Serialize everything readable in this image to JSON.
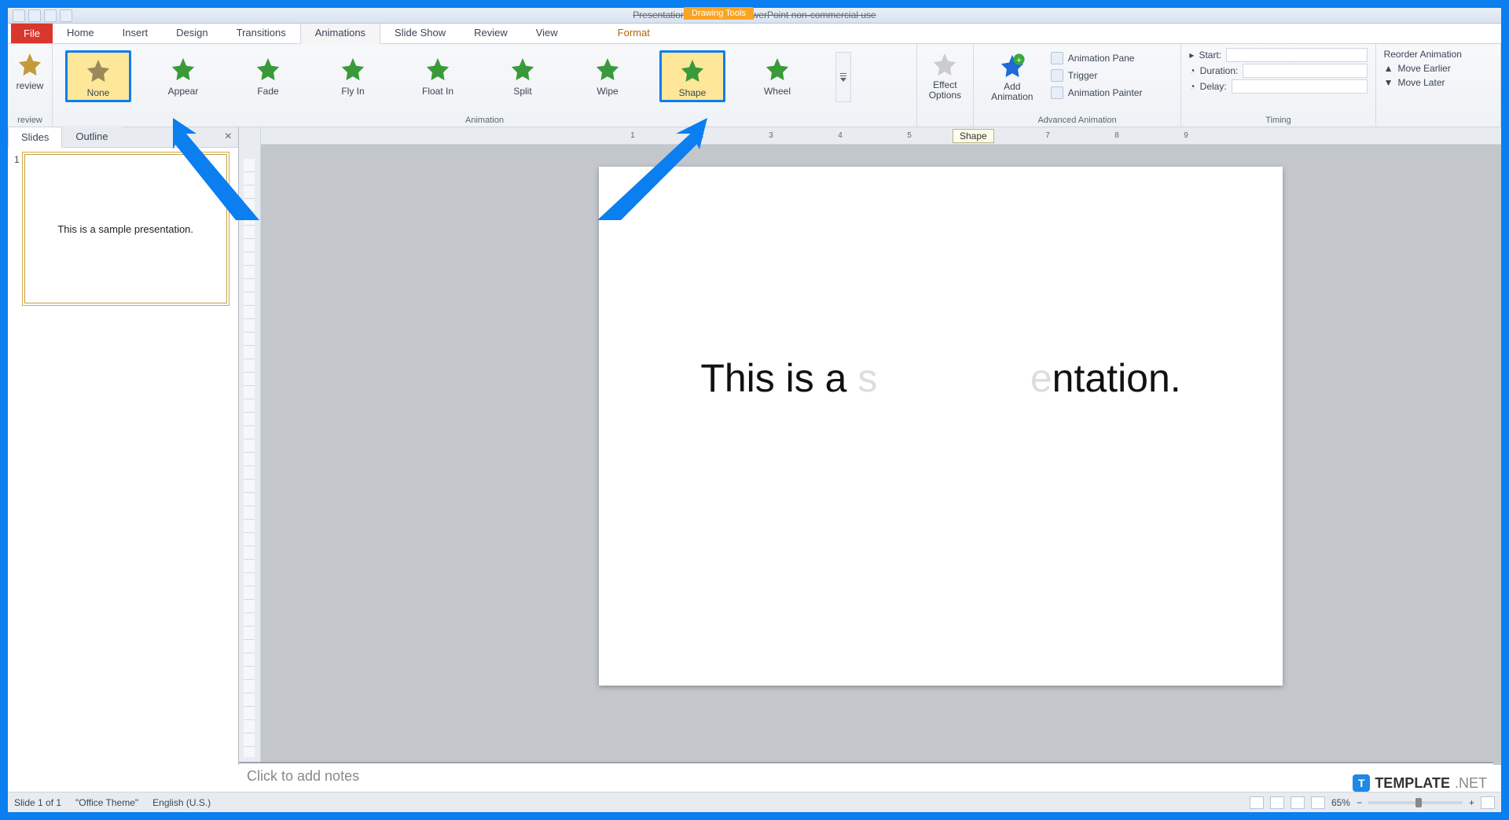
{
  "window": {
    "title": "Presentation1 - Microsoft PowerPoint non-commercial use",
    "context_tab": "Drawing Tools"
  },
  "tabs": {
    "file": "File",
    "home": "Home",
    "insert": "Insert",
    "design": "Design",
    "transitions": "Transitions",
    "animations": "Animations",
    "slideshow": "Slide Show",
    "review": "Review",
    "view": "View",
    "format": "Format"
  },
  "ribbon": {
    "preview": "review",
    "preview_label": "review",
    "animations": [
      {
        "key": "none",
        "label": "None",
        "color": "#9a8a5a"
      },
      {
        "key": "appear",
        "label": "Appear",
        "color": "#3a9a3a"
      },
      {
        "key": "fade",
        "label": "Fade",
        "color": "#3a9a3a"
      },
      {
        "key": "flyin",
        "label": "Fly In",
        "color": "#3a9a3a"
      },
      {
        "key": "floatin",
        "label": "Float In",
        "color": "#3a9a3a"
      },
      {
        "key": "split",
        "label": "Split",
        "color": "#3a9a3a"
      },
      {
        "key": "wipe",
        "label": "Wipe",
        "color": "#3a9a3a"
      },
      {
        "key": "shape",
        "label": "Shape",
        "color": "#3a9a3a"
      },
      {
        "key": "wheel",
        "label": "Wheel",
        "color": "#3a9a3a"
      }
    ],
    "group_labels": {
      "preview": "review",
      "animation": "Animation",
      "advanced": "Advanced Animation",
      "timing": "Timing"
    },
    "effect_options": "Effect\nOptions",
    "add_animation": "Add\nAnimation",
    "anim_pane": "Animation Pane",
    "trigger": "Trigger",
    "anim_painter": "Animation Painter",
    "start": "Start:",
    "duration": "Duration:",
    "delay": "Delay:",
    "reorder": "Reorder Animation",
    "move_earlier": "Move Earlier",
    "move_later": "Move Later"
  },
  "panel": {
    "tabs": {
      "slides": "Slides",
      "outline": "Outline"
    },
    "thumb_text": "This is a sample presentation.",
    "slide_num": "1"
  },
  "tooltip": "Shape",
  "slide": {
    "part1": "This is a ",
    "fade1": "s",
    "gap": "              ",
    "fade2": "e",
    "part2": "ntation."
  },
  "notes_placeholder": "Click to add notes",
  "status": {
    "slide": "Slide 1 of 1",
    "theme": "\"Office Theme\"",
    "lang": "English (U.S.)",
    "zoom": "65%"
  },
  "brand": {
    "name": "TEMPLATE",
    "suffix": ".NET"
  }
}
